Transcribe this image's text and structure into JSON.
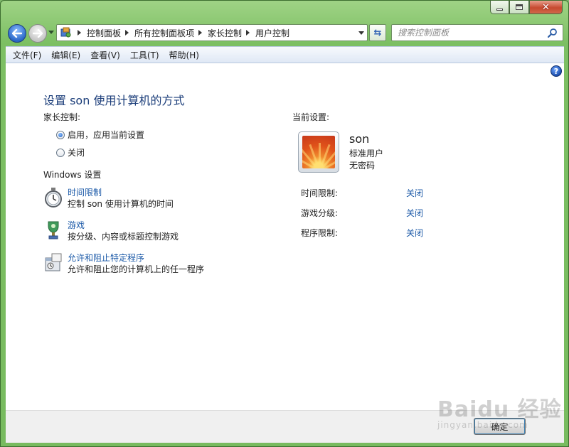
{
  "window": {
    "caption": {
      "minimize_icon": "minimize-icon",
      "maximize_icon": "maximize-icon",
      "close_icon": "close-icon"
    }
  },
  "nav": {
    "breadcrumbs": [
      "控制面板",
      "所有控制面板项",
      "家长控制",
      "用户控制"
    ],
    "search_placeholder": "搜索控制面板"
  },
  "menu": [
    "文件(F)",
    "编辑(E)",
    "查看(V)",
    "工具(T)",
    "帮助(H)"
  ],
  "help_glyph": "?",
  "page": {
    "title": "设置 son 使用计算机的方式",
    "parental_control_label": "家长控制:",
    "radio_on": "启用，应用当前设置",
    "radio_off": "关闭",
    "radio_selected": "on",
    "windows_settings_label": "Windows 设置",
    "settings": [
      {
        "link": "时间限制",
        "desc": "控制 son 使用计算机的时间",
        "icon": "stopwatch-icon"
      },
      {
        "link": "游戏",
        "desc": "按分级、内容或标题控制游戏",
        "icon": "game-trophy-icon"
      },
      {
        "link": "允许和阻止特定程序",
        "desc": "允许和阻止您的计算机上的任一程序",
        "icon": "program-window-icon"
      }
    ],
    "current_settings_label": "当前设置:",
    "user": {
      "name": "son",
      "type": "标准用户",
      "password": "无密码"
    },
    "status": [
      {
        "label": "时间限制:",
        "value": "关闭"
      },
      {
        "label": "游戏分级:",
        "value": "关闭"
      },
      {
        "label": "程序限制:",
        "value": "关闭"
      }
    ]
  },
  "footer": {
    "ok_label": "确定"
  },
  "watermark": {
    "main": "Baidu 经验",
    "sub": "jingyan.baidu.com"
  }
}
